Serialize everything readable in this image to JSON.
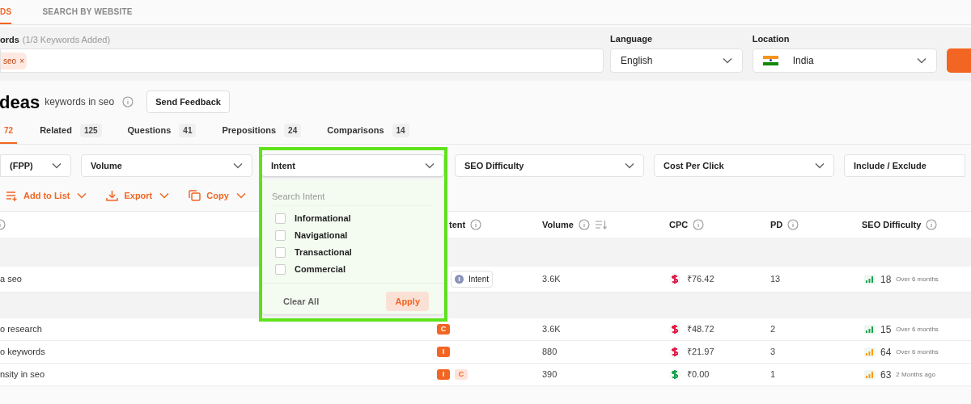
{
  "top_tabs": [
    {
      "label": "DS",
      "selected": true
    },
    {
      "label": "SEARCH BY WEBSITE",
      "selected": false
    }
  ],
  "search": {
    "keywords_label": "ords",
    "keywords_hint": "(1/3 Keywords Added)",
    "chips": [
      {
        "label": "seo",
        "remove": "×"
      }
    ],
    "language_label": "Language",
    "language": "English",
    "location_label": "Location",
    "location": "India"
  },
  "heading": {
    "title": "deas",
    "subtitle": "keywords in seo",
    "feedback_button": "Send Feedback"
  },
  "result_tabs": [
    {
      "count": "72",
      "selected": true
    },
    {
      "label": "Related",
      "count": "125",
      "selected": false
    },
    {
      "label": "Questions",
      "count": "41",
      "selected": false
    },
    {
      "label": "Prepositions",
      "count": "24",
      "selected": false
    },
    {
      "label": "Comparisons",
      "count": "14",
      "selected": false
    }
  ],
  "filters": [
    {
      "label": "(FPP)",
      "open": false
    },
    {
      "label": "Volume",
      "open": false
    },
    {
      "label": "Intent",
      "open": true
    },
    {
      "label": "SEO Difficulty",
      "open": false
    },
    {
      "label": "Cost Per Click",
      "open": false
    },
    {
      "label": "Include / Exclude",
      "open": false
    }
  ],
  "actions": [
    "Add to List",
    "Export",
    "Copy"
  ],
  "table": {
    "columns": [
      "",
      "tent",
      "Volume",
      "CPC",
      "PD",
      "SEO Difficulty"
    ],
    "rows": [
      {
        "kind": "group"
      },
      {
        "kind": "keyword",
        "keyword": "a seo",
        "intents": [
          {
            "kind": "tag",
            "label": "Intent"
          }
        ],
        "volume": "3.6K",
        "cpc": {
          "value": "₹76.42",
          "color": "#e11d48"
        },
        "pd": "13",
        "difficulty": {
          "value": "18",
          "color": "#16a34a"
        },
        "updated": "Over 6 months"
      },
      {
        "kind": "group"
      },
      {
        "kind": "keyword",
        "keyword": "o research",
        "intents": [
          {
            "kind": "solid",
            "label": "C"
          }
        ],
        "volume": "3.6K",
        "cpc": {
          "value": "₹48.72",
          "color": "#e11d48"
        },
        "pd": "2",
        "difficulty": {
          "value": "15",
          "color": "#16a34a"
        },
        "updated": "Over 6 months"
      },
      {
        "kind": "keyword",
        "keyword": "o keywords",
        "intents": [
          {
            "kind": "solid",
            "label": "I"
          }
        ],
        "volume": "880",
        "cpc": {
          "value": "₹21.97",
          "color": "#e11d48"
        },
        "pd": "3",
        "difficulty": {
          "value": "64",
          "color": "#f59e0b"
        },
        "updated": "Over 6 months"
      },
      {
        "kind": "keyword",
        "keyword": "nsity in seo",
        "intents": [
          {
            "kind": "solid",
            "label": "I"
          },
          {
            "kind": "soft",
            "label": "C"
          }
        ],
        "volume": "390",
        "cpc": {
          "value": "₹0.00",
          "color": "#16a34a"
        },
        "pd": "1",
        "difficulty": {
          "value": "63",
          "color": "#f59e0b"
        },
        "updated": "2 Months ago"
      }
    ]
  },
  "intent_dropdown": {
    "search_placeholder": "Search Intent",
    "options": [
      {
        "label": "Informational",
        "checked": false
      },
      {
        "label": "Navigational",
        "checked": false
      },
      {
        "label": "Transactional",
        "checked": false
      },
      {
        "label": "Commercial",
        "checked": false
      }
    ],
    "clear": "Clear All",
    "apply": "Apply"
  }
}
